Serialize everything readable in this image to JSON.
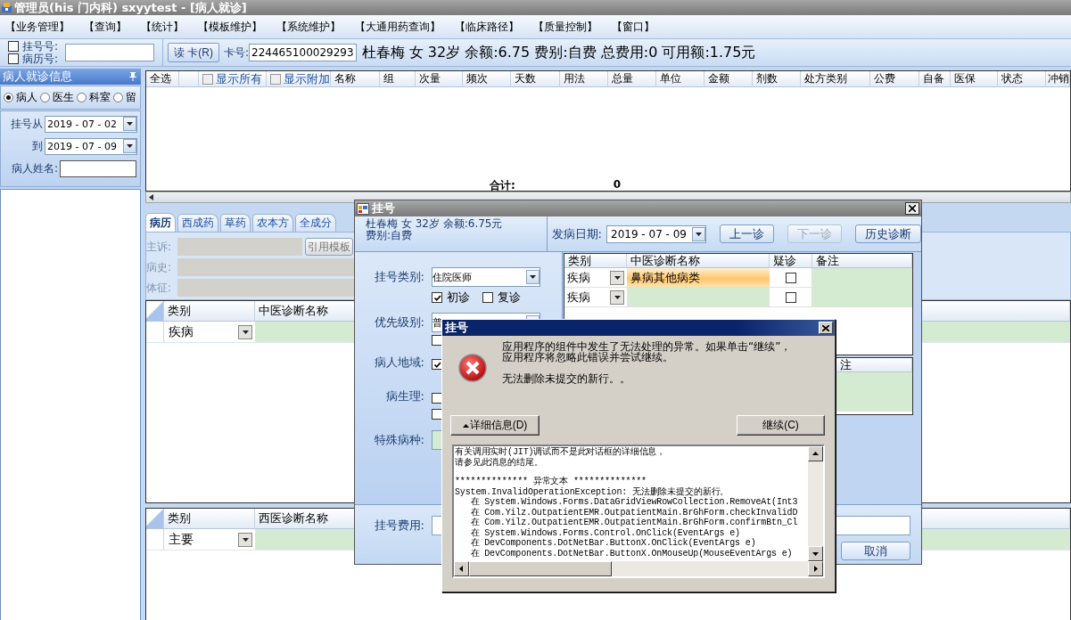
{
  "window": {
    "title": "管理员(his 门内科) sxyytest - [病人就诊]"
  },
  "menu": [
    {
      "label": "【业务管理】"
    },
    {
      "label": "【查询】"
    },
    {
      "label": "【统计】"
    },
    {
      "label": "【模板维护】"
    },
    {
      "label": "【系统维护】"
    },
    {
      "label": "【大通用药查询】"
    },
    {
      "label": "【临床路径】"
    },
    {
      "label": "【质量控制】"
    },
    {
      "label": "【窗口】"
    }
  ],
  "toolbar": {
    "lookup_options": [
      {
        "label": "挂号号:",
        "checked": false
      },
      {
        "label": "病历号:",
        "checked": false
      }
    ],
    "read_card_button": "读 卡(R)",
    "card_label": "卡号:",
    "card_number": "224465100029293",
    "patient_summary": "杜春梅 女 32岁 余额:6.75 费别:自费 总费用:0 可用额:1.75元"
  },
  "sidebar": {
    "title": "病人就诊信息",
    "filters": [
      {
        "label": "病人",
        "selected": true
      },
      {
        "label": "医生",
        "selected": false
      },
      {
        "label": "科室",
        "selected": false
      },
      {
        "label": "留",
        "selected": false
      }
    ],
    "date_from_label": "挂号从",
    "date_from": "2019 - 07 - 02",
    "date_to_label": "到",
    "date_to": "2019 - 07 - 09",
    "name_label": "病人姓名:"
  },
  "prescription_table": {
    "columns": [
      {
        "kind": "text",
        "label": "全选"
      },
      {
        "kind": "blank"
      },
      {
        "kind": "checkbox",
        "label": "显示所有",
        "checked": false
      },
      {
        "kind": "checkbox",
        "label": "显示附加",
        "checked": false
      },
      {
        "kind": "text",
        "label": "名称"
      },
      {
        "kind": "text",
        "label": "组"
      },
      {
        "kind": "text",
        "label": "次量"
      },
      {
        "kind": "text",
        "label": "频次"
      },
      {
        "kind": "text",
        "label": "天数"
      },
      {
        "kind": "text",
        "label": "用法"
      },
      {
        "kind": "text",
        "label": "总量"
      },
      {
        "kind": "text",
        "label": "单位"
      },
      {
        "kind": "text",
        "label": "金额"
      },
      {
        "kind": "text",
        "label": "剂数"
      },
      {
        "kind": "text",
        "label": "处方类别"
      },
      {
        "kind": "text",
        "label": "公费"
      },
      {
        "kind": "text",
        "label": "自备"
      },
      {
        "kind": "text",
        "label": "医保"
      },
      {
        "kind": "text",
        "label": "状态"
      },
      {
        "kind": "text",
        "label": "冲销"
      }
    ],
    "total_label": "合计:",
    "total_value": "0"
  },
  "record_tabs": [
    {
      "label": "病历",
      "selected": true
    },
    {
      "label": "西成药",
      "selected": false
    },
    {
      "label": "草药",
      "selected": false
    },
    {
      "label": "农本方",
      "selected": false
    },
    {
      "label": "全成分",
      "selected": false
    }
  ],
  "record_fields": [
    {
      "label": "主诉:"
    },
    {
      "label": "病史:"
    },
    {
      "label": "体征:"
    }
  ],
  "template_button": "引用模板",
  "tcm_diagnosis_table": {
    "columns": [
      "类别",
      "中医诊断名称"
    ],
    "rows": [
      {
        "category": "疾病"
      }
    ]
  },
  "western_diagnosis_table": {
    "columns": [
      "类别",
      "西医诊断名称"
    ],
    "rows": [
      {
        "category": "主要"
      }
    ]
  },
  "registration_dialog": {
    "title": "挂号",
    "patient_line": "杜春梅 女 32岁 余额:6.75元",
    "fee_type": "费别:自费",
    "onset_date_label": "发病日期:",
    "onset_date": "2019 - 07 - 09",
    "buttons": [
      {
        "label": "上一诊",
        "disabled": false
      },
      {
        "label": "下一诊",
        "disabled": true
      },
      {
        "label": "历史诊断",
        "disabled": false
      }
    ],
    "form_rows": [
      {
        "kind": "dropdown",
        "label": "挂号类别:",
        "value": "住院医师",
        "options": [
          {
            "label": "初诊",
            "checked": true
          },
          {
            "label": "复诊",
            "checked": false
          }
        ]
      },
      {
        "kind": "dropdown",
        "label": "优先级别:",
        "value": "普",
        "options": [
          {
            "checked": false
          }
        ]
      },
      {
        "kind": "checks",
        "label": "病人地域:",
        "options": [
          {
            "checked": true
          }
        ]
      },
      {
        "kind": "checks",
        "label": "病生理:",
        "options": [
          {
            "checked": false
          },
          {
            "checked": false
          }
        ]
      },
      {
        "kind": "field",
        "label": "特殊病种:"
      }
    ],
    "diagnosis_table": {
      "columns": [
        "类别",
        "中医诊断名称",
        "疑诊",
        "备注"
      ],
      "rows": [
        {
          "category": "疾病",
          "name": "鼻病其他病类",
          "suspected": false,
          "selected": true
        },
        {
          "category": "疾病",
          "suspected": false,
          "selected": false
        }
      ]
    },
    "lower_table_header": "注",
    "fee_label": "挂号费用:",
    "cancel_button": "取消"
  },
  "error_dialog": {
    "title": "挂号",
    "message_lines": [
      "应用程序的组件中发生了无法处理的异常。如果单击“继续”，",
      "应用程序将忽略此错误并尝试继续。"
    ],
    "detail_message": "无法删除未提交的新行。。",
    "details_button": "详细信息(D)",
    "continue_button": "继续(C)",
    "details": [
      [
        "有关调用实时(JIT)调试而不是此对话框的详细信息，",
        "请参见此消息的结尾。"
      ],
      [
        "************** 异常文本 **************",
        "System.InvalidOperationException: 无法删除未提交的新行。",
        "   在 System.Windows.Forms.DataGridViewRowCollection.RemoveAt(Int3",
        "   在 Com.Yilz.OutpatientEMR.OutpatientMain.BrGhForm.checkInvalidD",
        "   在 Com.Yilz.OutpatientEMR.OutpatientMain.BrGhForm.confirmBtn_Cl",
        "   在 System.Windows.Forms.Control.OnClick(EventArgs e)",
        "   在 DevComponents.DotNetBar.ButtonX.OnClick(EventArgs e)",
        "   在 DevComponents.DotNetBar.ButtonX.OnMouseUp(MouseEventArgs e)"
      ]
    ]
  }
}
